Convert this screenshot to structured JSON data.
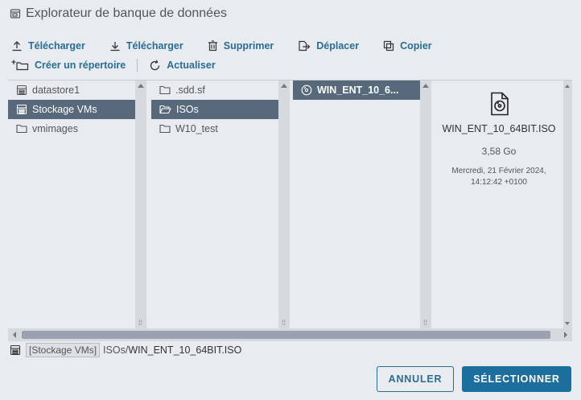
{
  "dialog": {
    "title": "Explorateur de banque de données"
  },
  "toolbar": {
    "upload_label": "Télécharger",
    "download_label": "Télécharger",
    "delete_label": "Supprimer",
    "move_label": "Déplacer",
    "copy_label": "Copier",
    "new_folder_label": "Créer un répertoire",
    "refresh_label": "Actualiser"
  },
  "columns": {
    "datastores": [
      {
        "label": "datastore1",
        "icon": "datastore-icon",
        "selected": false
      },
      {
        "label": "Stockage VMs",
        "icon": "datastore-icon",
        "selected": true
      },
      {
        "label": "vmimages",
        "icon": "folder-icon",
        "selected": false
      }
    ],
    "folders": [
      {
        "label": ".sdd.sf",
        "icon": "folder-icon",
        "selected": false
      },
      {
        "label": "ISOs",
        "icon": "folder-open-icon",
        "selected": true
      },
      {
        "label": "W10_test",
        "icon": "folder-icon",
        "selected": false
      }
    ],
    "files": [
      {
        "label": "WIN_ENT_10_6...",
        "icon": "disc-icon",
        "selected": true
      }
    ]
  },
  "details": {
    "file_name": "WIN_ENT_10_64BIT.ISO",
    "file_size": "3,58 Go",
    "modified_line1": "Mercredi, 21 Février 2024,",
    "modified_line2": "14:12:42 +0100"
  },
  "path": {
    "datastore_tag": "[Stockage VMs]",
    "folder": "ISOs/",
    "file": "WIN_ENT_10_64BIT.ISO"
  },
  "buttons": {
    "cancel_label": "ANNULER",
    "select_label": "SÉLECTIONNER"
  },
  "colors": {
    "accent": "#2a6d95",
    "primary_button": "#1b6e9e",
    "selection": "#57697a",
    "background": "#e8ebef"
  }
}
